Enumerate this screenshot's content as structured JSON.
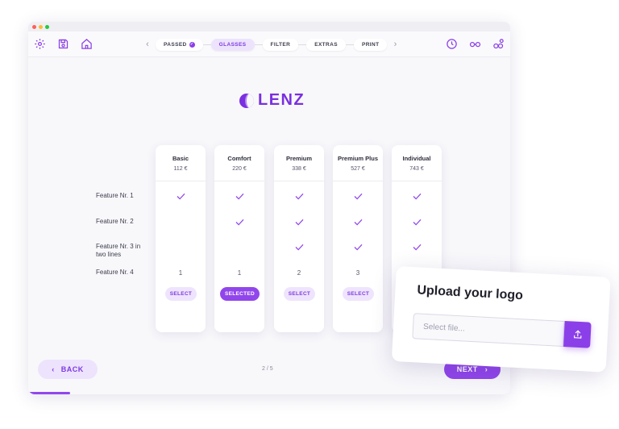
{
  "toolbar": {
    "steps": [
      {
        "label": "PASSED",
        "done": true
      },
      {
        "label": "GLASSES",
        "active": true
      },
      {
        "label": "FILTER"
      },
      {
        "label": "EXTRAS"
      },
      {
        "label": "PRINT"
      }
    ],
    "icons_left": [
      "settings-icon",
      "save-icon",
      "home-icon"
    ],
    "icons_right": [
      "clock-icon",
      "glasses-icon",
      "share-icon"
    ]
  },
  "brand": {
    "name": "LENZ",
    "color": "#7a2fe0"
  },
  "features": [
    "Feature Nr. 1",
    "Feature Nr. 2",
    "Feature Nr. 3 in two lines",
    "Feature Nr. 4"
  ],
  "plans": [
    {
      "name": "Basic",
      "price": "112 €",
      "f1": true,
      "f2": false,
      "f3": false,
      "f4": "1",
      "button": "SELECT",
      "selected": false
    },
    {
      "name": "Comfort",
      "price": "220 €",
      "f1": true,
      "f2": true,
      "f3": false,
      "f4": "1",
      "button": "SELECTED",
      "selected": true
    },
    {
      "name": "Premium",
      "price": "338 €",
      "f1": true,
      "f2": true,
      "f3": true,
      "f4": "2",
      "button": "SELECT",
      "selected": false
    },
    {
      "name": "Premium Plus",
      "price": "527 €",
      "f1": true,
      "f2": true,
      "f3": true,
      "f4": "3",
      "button": "SELECT",
      "selected": false
    },
    {
      "name": "Individual",
      "price": "743 €",
      "f1": true,
      "f2": true,
      "f3": true,
      "f4": "",
      "button": "",
      "selected": false
    }
  ],
  "footer": {
    "back": "BACK",
    "pager": "2 / 5",
    "next": "NEXT"
  },
  "upload": {
    "title": "Upload your logo",
    "placeholder": "Select file..."
  },
  "colors": {
    "accent": "#9146ec",
    "accent_light": "#ede3fd"
  }
}
